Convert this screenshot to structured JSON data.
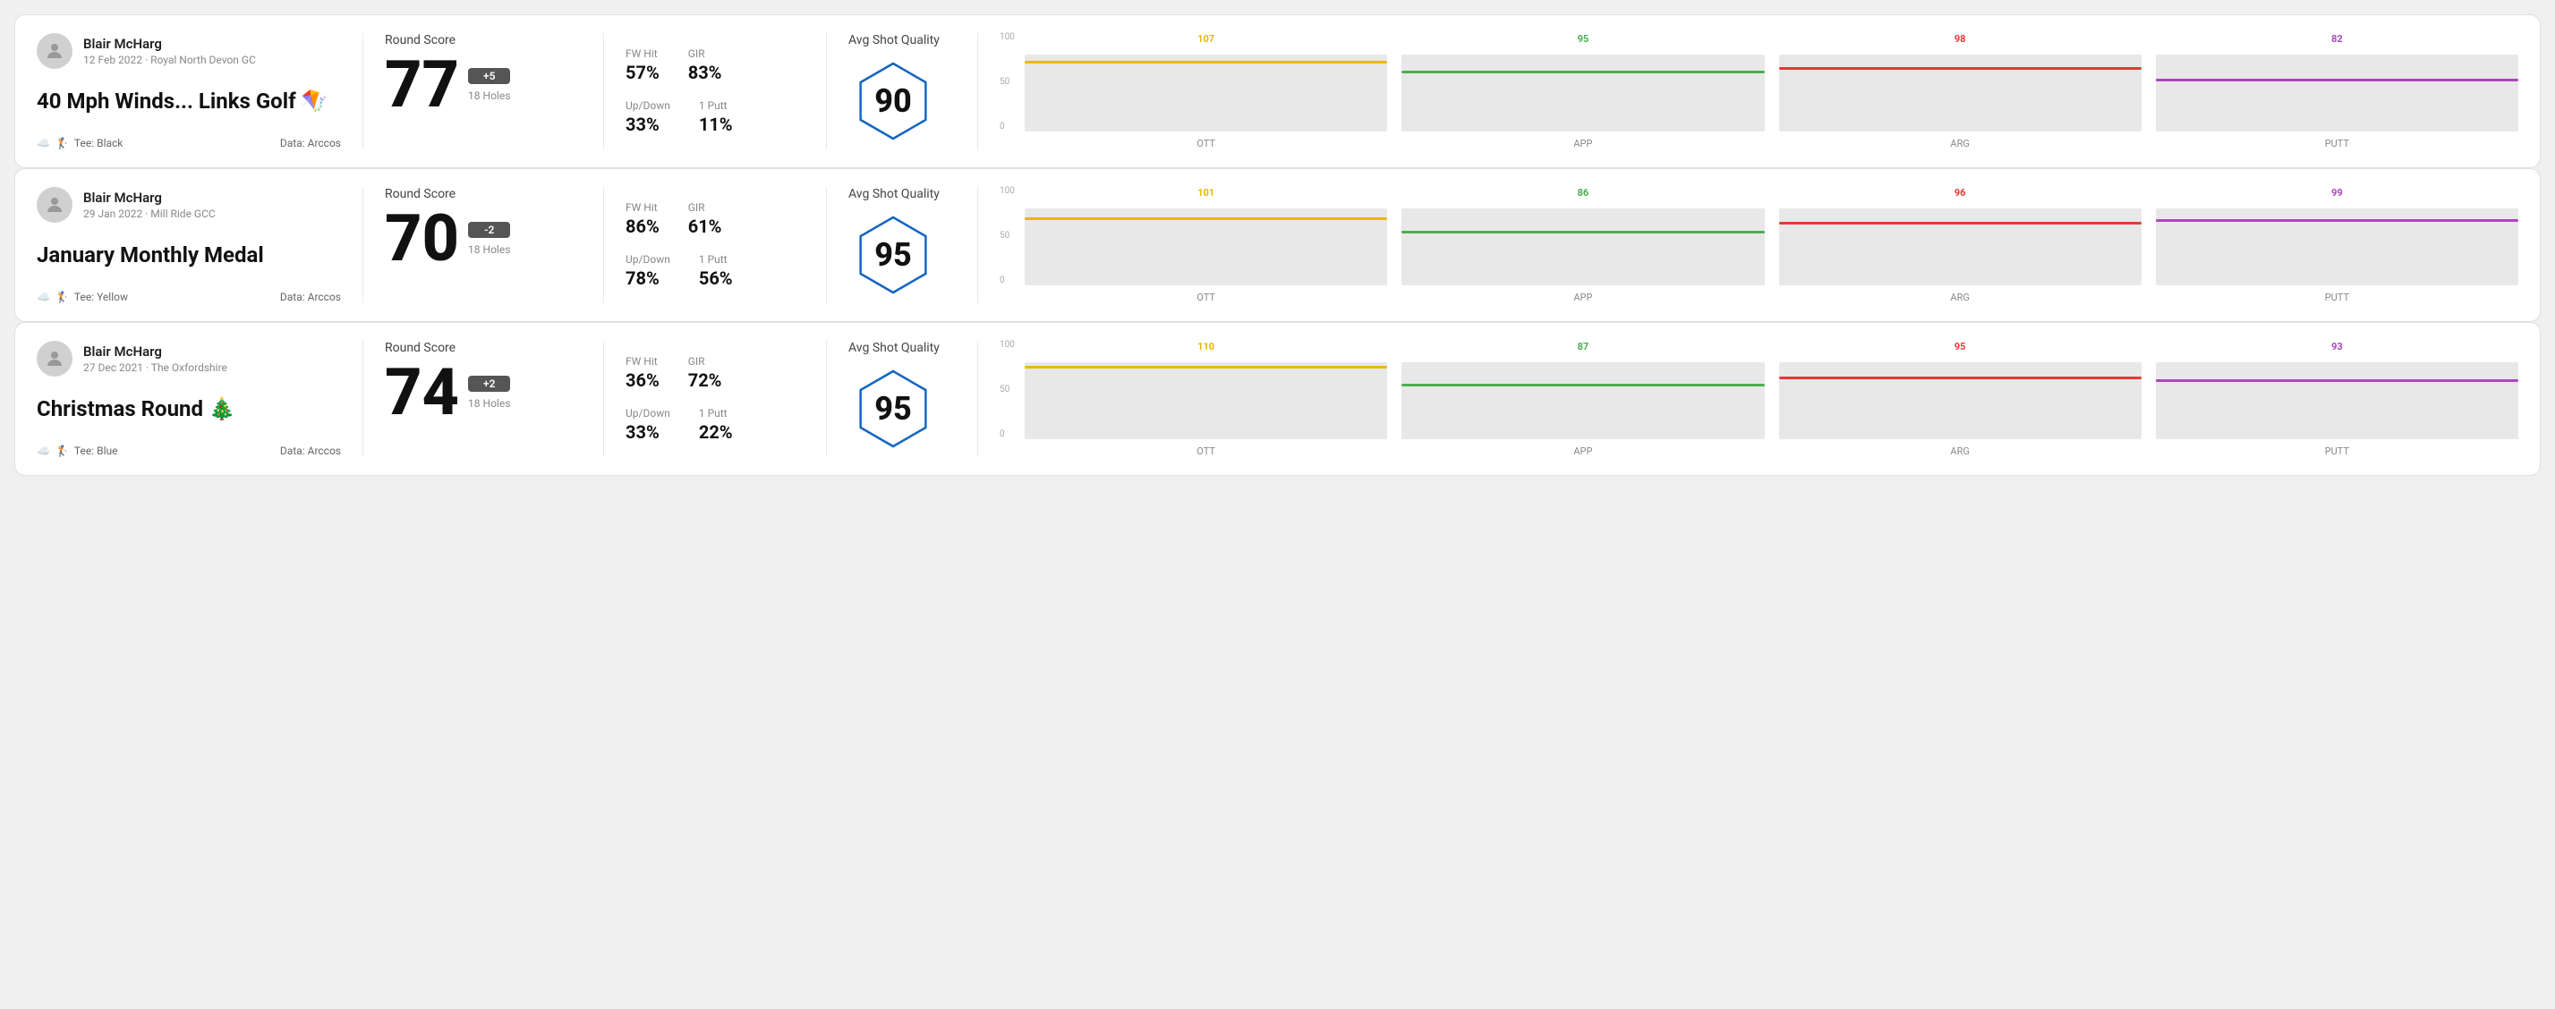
{
  "cards": [
    {
      "id": "card1",
      "user": {
        "name": "Blair McHarg",
        "meta": "12 Feb 2022 · Royal North Devon GC"
      },
      "title": "40 Mph Winds... Links Golf 🪁",
      "tee": "Tee: Black",
      "data_source": "Data: Arccos",
      "round_score_label": "Round Score",
      "score": "77",
      "badge": "+5",
      "holes": "18 Holes",
      "stats": {
        "fw_hit_label": "FW Hit",
        "fw_hit_val": "57%",
        "gir_label": "GIR",
        "gir_val": "83%",
        "updown_label": "Up/Down",
        "updown_val": "33%",
        "oneputt_label": "1 Putt",
        "oneputt_val": "11%"
      },
      "avg_shot_quality_label": "Avg Shot Quality",
      "hex_score": "90",
      "chart": {
        "bars": [
          {
            "label": "OTT",
            "value": 107,
            "color": "#e8b800",
            "pct": 75
          },
          {
            "label": "APP",
            "value": 95,
            "color": "#4caf50",
            "pct": 65
          },
          {
            "label": "ARG",
            "value": 98,
            "color": "#e53935",
            "pct": 68
          },
          {
            "label": "PUTT",
            "value": 82,
            "color": "#ab47bc",
            "pct": 55
          }
        ],
        "y_labels": [
          "100",
          "50",
          "0"
        ]
      }
    },
    {
      "id": "card2",
      "user": {
        "name": "Blair McHarg",
        "meta": "29 Jan 2022 · Mill Ride GCC"
      },
      "title": "January Monthly Medal",
      "tee": "Tee: Yellow",
      "data_source": "Data: Arccos",
      "round_score_label": "Round Score",
      "score": "70",
      "badge": "-2",
      "holes": "18 Holes",
      "stats": {
        "fw_hit_label": "FW Hit",
        "fw_hit_val": "86%",
        "gir_label": "GIR",
        "gir_val": "61%",
        "updown_label": "Up/Down",
        "updown_val": "78%",
        "oneputt_label": "1 Putt",
        "oneputt_val": "56%"
      },
      "avg_shot_quality_label": "Avg Shot Quality",
      "hex_score": "95",
      "chart": {
        "bars": [
          {
            "label": "OTT",
            "value": 101,
            "color": "#e8b800",
            "pct": 72
          },
          {
            "label": "APP",
            "value": 86,
            "color": "#4caf50",
            "pct": 58
          },
          {
            "label": "ARG",
            "value": 96,
            "color": "#e53935",
            "pct": 67
          },
          {
            "label": "PUTT",
            "value": 99,
            "color": "#ab47bc",
            "pct": 70
          }
        ],
        "y_labels": [
          "100",
          "50",
          "0"
        ]
      }
    },
    {
      "id": "card3",
      "user": {
        "name": "Blair McHarg",
        "meta": "27 Dec 2021 · The Oxfordshire"
      },
      "title": "Christmas Round 🎄",
      "tee": "Tee: Blue",
      "data_source": "Data: Arccos",
      "round_score_label": "Round Score",
      "score": "74",
      "badge": "+2",
      "holes": "18 Holes",
      "stats": {
        "fw_hit_label": "FW Hit",
        "fw_hit_val": "36%",
        "gir_label": "GIR",
        "gir_val": "72%",
        "updown_label": "Up/Down",
        "updown_val": "33%",
        "oneputt_label": "1 Putt",
        "oneputt_val": "22%"
      },
      "avg_shot_quality_label": "Avg Shot Quality",
      "hex_score": "95",
      "chart": {
        "bars": [
          {
            "label": "OTT",
            "value": 110,
            "color": "#e8b800",
            "pct": 78
          },
          {
            "label": "APP",
            "value": 87,
            "color": "#4caf50",
            "pct": 59
          },
          {
            "label": "ARG",
            "value": 95,
            "color": "#e53935",
            "pct": 66
          },
          {
            "label": "PUTT",
            "value": 93,
            "color": "#ab47bc",
            "pct": 64
          }
        ],
        "y_labels": [
          "100",
          "50",
          "0"
        ]
      }
    }
  ]
}
